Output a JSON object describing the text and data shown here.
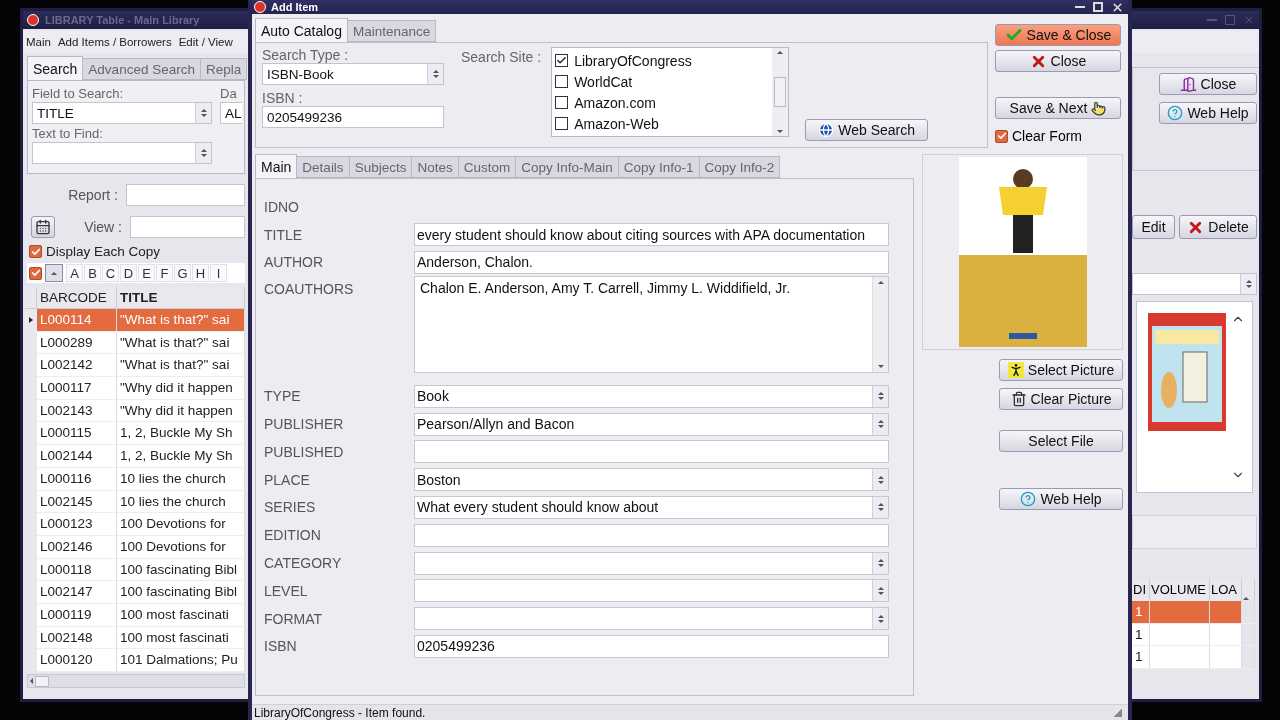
{
  "back_window": {
    "title": "LIBRARY Table - Main Library",
    "menu": [
      "Main",
      "Add Items / Borrowers",
      "Edit / View"
    ],
    "tabs": [
      {
        "label": "Search",
        "selected": true
      },
      {
        "label": "Advanced Search",
        "selected": false
      },
      {
        "label": "Repla",
        "selected": false
      }
    ],
    "field_to_search": {
      "label": "Field to Search:",
      "value": "TITLE"
    },
    "column_2": {
      "label": "Da",
      "value": "AL"
    },
    "text_to_find": {
      "label": "Text to Find:"
    },
    "report": {
      "label": "Report :"
    },
    "view": {
      "label": "View :"
    },
    "display_each_copy": {
      "label": "Display Each Copy",
      "checked": true
    },
    "letter_filter": {
      "checked": true,
      "letters": [
        "A",
        "B",
        "C",
        "D",
        "E",
        "F",
        "G",
        "H",
        "I"
      ]
    },
    "table": {
      "columns": [
        "BARCODE",
        "TITLE"
      ],
      "rows": [
        {
          "cells": [
            "L000114",
            "\"What is that?\" sai"
          ],
          "selected": true
        },
        {
          "cells": [
            "L000289",
            "\"What is that?\" sai"
          ],
          "selected": false
        },
        {
          "cells": [
            "L002142",
            "\"What is that?\" sai"
          ],
          "selected": false
        },
        {
          "cells": [
            "L000117",
            "\"Why did it happen"
          ],
          "selected": false
        },
        {
          "cells": [
            "L002143",
            "\"Why did it happen"
          ],
          "selected": false
        },
        {
          "cells": [
            "L000115",
            "1, 2, Buckle My Sh"
          ],
          "selected": false
        },
        {
          "cells": [
            "L002144",
            "1, 2, Buckle My Sh"
          ],
          "selected": false
        },
        {
          "cells": [
            "L000116",
            "10 lies the church"
          ],
          "selected": false
        },
        {
          "cells": [
            "L002145",
            "10 lies the church"
          ],
          "selected": false
        },
        {
          "cells": [
            "L000123",
            "100 Devotions for"
          ],
          "selected": false
        },
        {
          "cells": [
            "L002146",
            "100 Devotions for"
          ],
          "selected": false
        },
        {
          "cells": [
            "L000118",
            "100 fascinating Bibl"
          ],
          "selected": false
        },
        {
          "cells": [
            "L002147",
            "100 fascinating Bibl"
          ],
          "selected": false
        },
        {
          "cells": [
            "L000119",
            "100 most fascinati"
          ],
          "selected": false
        },
        {
          "cells": [
            "L002148",
            "100 most fascinati"
          ],
          "selected": false
        },
        {
          "cells": [
            "L000120",
            "101 Dalmations; Pu"
          ],
          "selected": false
        }
      ]
    },
    "right_buttons": [
      {
        "label": "Close",
        "kind": "exit"
      },
      {
        "label": "Web Help",
        "kind": "help"
      }
    ],
    "record_buttons": [
      {
        "label": "Edit",
        "kind": "plain"
      },
      {
        "label": "Delete",
        "kind": "delete"
      }
    ],
    "copies_table": {
      "columns": [
        "DI",
        "VOLUME",
        "LOA"
      ],
      "rows": [
        {
          "cells": [
            "1",
            "",
            ""
          ],
          "selected": true
        },
        {
          "cells": [
            "1",
            "",
            ""
          ],
          "selected": false
        },
        {
          "cells": [
            "1",
            "",
            ""
          ],
          "selected": false
        }
      ]
    }
  },
  "dialog": {
    "title": "Add Item",
    "tabs": [
      {
        "label": "Auto Catalog",
        "selected": true
      },
      {
        "label": "Maintenance",
        "selected": false
      }
    ],
    "search_type": {
      "label": "Search Type :",
      "value": "ISBN-Book"
    },
    "isbn": {
      "label": "ISBN :",
      "value": "0205499236"
    },
    "search_site": {
      "label": "Search Site :",
      "items": [
        {
          "label": "LibraryOfCongress",
          "checked": true
        },
        {
          "label": "WorldCat",
          "checked": false
        },
        {
          "label": "Amazon.com",
          "checked": false
        },
        {
          "label": "Amazon-Web",
          "checked": false
        }
      ]
    },
    "web_search": {
      "label": "Web Search"
    },
    "actions": [
      {
        "label": "Save & Close",
        "kind": "save",
        "default": true
      },
      {
        "label": "Close",
        "kind": "close",
        "default": false
      },
      {
        "label": "Save & Next",
        "kind": "next",
        "default": false
      }
    ],
    "clear_form": {
      "label": "Clear Form",
      "checked": true
    },
    "record_tabs": [
      {
        "label": "Main",
        "selected": true
      },
      {
        "label": "Details",
        "selected": false
      },
      {
        "label": "Subjects",
        "selected": false
      },
      {
        "label": "Notes",
        "selected": false
      },
      {
        "label": "Custom",
        "selected": false
      },
      {
        "label": "Copy Info-Main",
        "selected": false
      },
      {
        "label": "Copy Info-1",
        "selected": false
      },
      {
        "label": "Copy Info-2",
        "selected": false
      }
    ],
    "fields": [
      {
        "label": "IDNO",
        "kind": "static"
      },
      {
        "label": "TITLE",
        "kind": "text",
        "value": "every student should know about citing sources with APA documentation"
      },
      {
        "label": "AUTHOR",
        "kind": "text",
        "value": "Anderson, Chalon."
      },
      {
        "label": "COAUTHORS",
        "kind": "memo",
        "value": "Chalon E. Anderson, Amy T. Carrell, Jimmy L. Widdifield, Jr."
      },
      {
        "label": "TYPE",
        "kind": "combo",
        "value": "Book"
      },
      {
        "label": "PUBLISHER",
        "kind": "combo",
        "value": "Pearson/Allyn and Bacon"
      },
      {
        "label": "PUBLISHED",
        "kind": "text"
      },
      {
        "label": "PLACE",
        "kind": "combo",
        "value": "Boston"
      },
      {
        "label": "SERIES",
        "kind": "combo",
        "value": "What every student should know about"
      },
      {
        "label": "EDITION",
        "kind": "text"
      },
      {
        "label": "CATEGORY",
        "kind": "combo"
      },
      {
        "label": "LEVEL",
        "kind": "combo"
      },
      {
        "label": "FORMAT",
        "kind": "combo"
      },
      {
        "label": "ISBN",
        "kind": "text",
        "value": "0205499236"
      }
    ],
    "picture_buttons": [
      {
        "label": "Select Picture",
        "kind": "picture"
      },
      {
        "label": "Clear Picture",
        "kind": "trash"
      },
      {
        "label": "Select File",
        "kind": "plain"
      },
      {
        "label": "Web Help",
        "kind": "help"
      }
    ],
    "status": "LibraryOfCongress - Item found."
  }
}
